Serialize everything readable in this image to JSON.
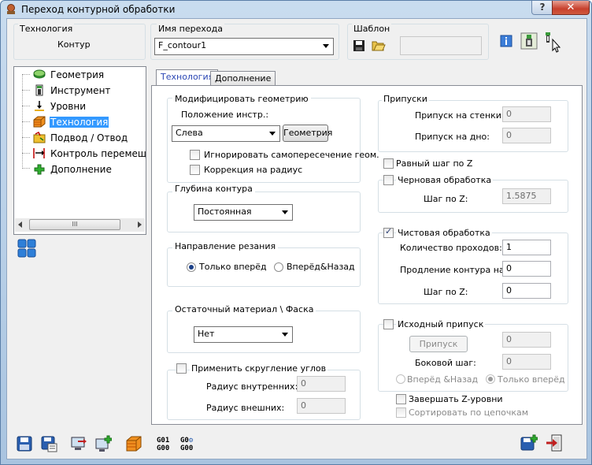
{
  "window": {
    "title": "Переход контурной обработки",
    "help_label": "?",
    "close_label": "✕"
  },
  "header": {
    "technology_label": "Технология",
    "technology_value": "Контур",
    "transition_name_label": "Имя перехода",
    "transition_name_value": "F_contour1",
    "template_label": "Шаблон",
    "template_value": ""
  },
  "tree": {
    "items": [
      {
        "label": "Геометрия",
        "icon": "geometry-icon"
      },
      {
        "label": "Инструмент",
        "icon": "tool-icon"
      },
      {
        "label": "Уровни",
        "icon": "levels-icon"
      },
      {
        "label": "Технология",
        "icon": "technology-icon",
        "selected": true
      },
      {
        "label": "Подвод / Отвод",
        "icon": "approach-icon"
      },
      {
        "label": "Контроль перемещен",
        "icon": "motion-control-icon"
      },
      {
        "label": "Дополнение",
        "icon": "addition-icon"
      }
    ],
    "scroll_thumb_label": "III"
  },
  "tabs": [
    {
      "label": "Технология",
      "active": true
    },
    {
      "label": "Дополнение",
      "active": false
    }
  ],
  "geometry_group": {
    "title": "Модифицировать геометрию",
    "position_label": "Положение инстр.:",
    "position_value": "Слева",
    "geometry_button": "Геометрия",
    "ignore_self_intersection": "Игнорировать самопересечение геом.",
    "radius_correction": "Коррекция на радиус"
  },
  "depth_group": {
    "title": "Глубина контура",
    "value": "Постоянная"
  },
  "direction_group": {
    "title": "Направление резания",
    "forward_only": "Только вперёд",
    "forward_back": "Вперёд&Назад"
  },
  "residual_group": {
    "title": "Остаточный материал \\ Фаска",
    "value": "Нет"
  },
  "corner_round": {
    "label": "Применить скругление углов",
    "inner_radius_label": "Радиус внутренних:",
    "inner_radius_value": "0",
    "outer_radius_label": "Радиус внешних:",
    "outer_radius_value": "0"
  },
  "allowance_group": {
    "title": "Припуски",
    "wall_label": "Припуск на стенки:",
    "wall_value": "0",
    "floor_label": "Припуск на дно:",
    "floor_value": "0"
  },
  "equal_z_step": "Равный шаг по Z",
  "rough_group": {
    "title": "Черновая обработка",
    "z_step_label": "Шаг по Z:",
    "z_step_value": "1.5875"
  },
  "finish_group": {
    "title": "Чистовая обработка",
    "passes_label": "Количество проходов:",
    "passes_value": "1",
    "extension_label": "Продление контура на:",
    "extension_value": "0",
    "z_step_label": "Шаг по Z:",
    "z_step_value": "0"
  },
  "initial_allowance": {
    "title": "Исходный припуск",
    "allowance_button": "Припуск",
    "allowance_value": "0",
    "side_step_label": "Боковой шаг:",
    "side_step_value": "0",
    "forward_back": "Вперёд &Назад",
    "forward_only": "Только вперёд"
  },
  "finish_z_levels": "Завершать Z-уровни",
  "sort_by_chains": "Сортировать по цепочкам",
  "gcode_labels": {
    "line1": "G01",
    "line2": "G00",
    "line3": "G0",
    "line4": "G00"
  },
  "colors": {
    "accent": "#3399ff",
    "window_frame": "#a9c4e0",
    "close_red": "#c7402d"
  }
}
